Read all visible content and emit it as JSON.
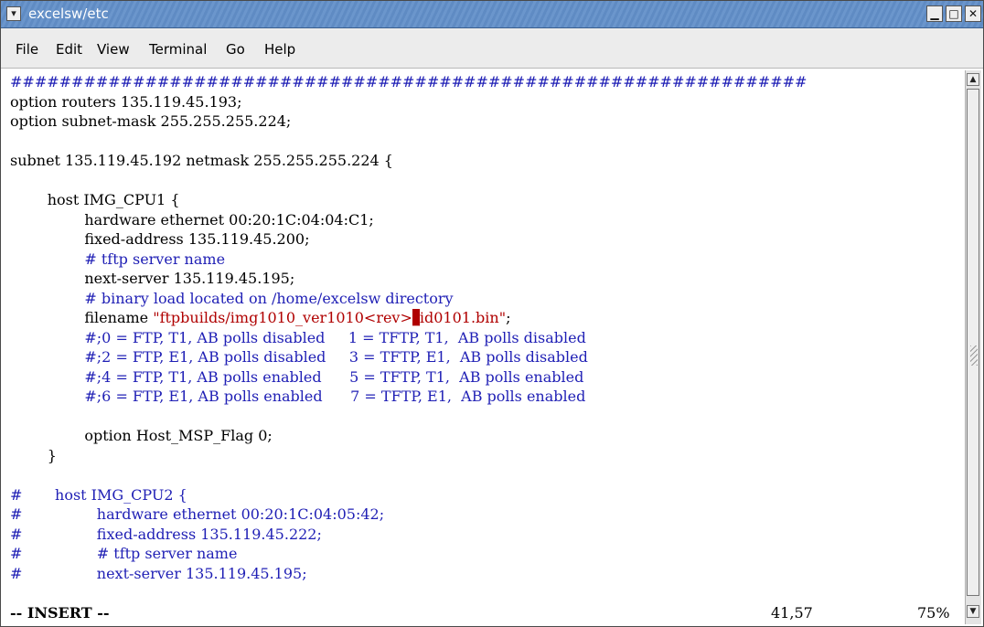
{
  "window": {
    "title": "excelsw/etc",
    "buttons": {
      "minimize": "▁",
      "maximize": "□",
      "close": "✕"
    }
  },
  "menu": [
    "File",
    "Edit",
    "View",
    "Terminal",
    "Go",
    "Help"
  ],
  "editor": {
    "lines": [
      [
        {
          "t": "#################################################################",
          "c": "hashrow"
        }
      ],
      [
        {
          "t": "option routers 135.119.45.193;",
          "c": ""
        }
      ],
      [
        {
          "t": "option subnet-mask 255.255.255.224;",
          "c": ""
        }
      ],
      [
        {
          "t": "",
          "c": ""
        }
      ],
      [
        {
          "t": "subnet 135.119.45.192 netmask 255.255.255.224 {",
          "c": ""
        }
      ],
      [
        {
          "t": "",
          "c": ""
        }
      ],
      [
        {
          "t": "        host IMG_CPU1 {",
          "c": ""
        }
      ],
      [
        {
          "t": "                hardware ethernet 00:20:1C:04:04:C1;",
          "c": ""
        }
      ],
      [
        {
          "t": "                fixed-address 135.119.45.200;",
          "c": ""
        }
      ],
      [
        {
          "t": "                # tftp server name",
          "c": "blue"
        }
      ],
      [
        {
          "t": "                next-server 135.119.45.195;",
          "c": ""
        }
      ],
      [
        {
          "t": "                # binary load located on /home/excelsw directory",
          "c": "blue"
        }
      ],
      [
        {
          "t": "                filename ",
          "c": ""
        },
        {
          "t": "\"ftpbuilds/img1010_ver1010<rev>",
          "c": "red"
        },
        {
          "t": "_",
          "c": "cursor"
        },
        {
          "t": "id0101.bin\"",
          "c": "red"
        },
        {
          "t": ";",
          "c": ""
        }
      ],
      [
        {
          "t": "                #;0 = FTP, T1, AB polls disabled     1 = TFTP, T1,  AB polls disabled",
          "c": "blue"
        }
      ],
      [
        {
          "t": "                #;2 = FTP, E1, AB polls disabled     3 = TFTP, E1,  AB polls disabled",
          "c": "blue"
        }
      ],
      [
        {
          "t": "                #;4 = FTP, T1, AB polls enabled      5 = TFTP, T1,  AB polls enabled",
          "c": "blue"
        }
      ],
      [
        {
          "t": "                #;6 = FTP, E1, AB polls enabled      7 = TFTP, E1,  AB polls enabled",
          "c": "blue"
        }
      ],
      [
        {
          "t": "",
          "c": ""
        }
      ],
      [
        {
          "t": "                option Host_MSP_Flag 0;",
          "c": ""
        }
      ],
      [
        {
          "t": "        }",
          "c": ""
        }
      ],
      [
        {
          "t": "",
          "c": ""
        }
      ],
      [
        {
          "t": "#",
          "c": "blue"
        },
        {
          "t": "       host IMG_CPU2 {",
          "c": "blue"
        }
      ],
      [
        {
          "t": "#",
          "c": "blue"
        },
        {
          "t": "                hardware ethernet 00:20:1C:04:05:42;",
          "c": "blue"
        }
      ],
      [
        {
          "t": "#",
          "c": "blue"
        },
        {
          "t": "                fixed-address 135.119.45.222;",
          "c": "blue"
        }
      ],
      [
        {
          "t": "#",
          "c": "blue"
        },
        {
          "t": "                # tftp server name",
          "c": "blue"
        }
      ],
      [
        {
          "t": "#",
          "c": "blue"
        },
        {
          "t": "                next-server 135.119.45.195;",
          "c": "blue"
        }
      ]
    ]
  },
  "status": {
    "mode": "-- INSERT --",
    "position": "41,57",
    "percent": "75%"
  }
}
